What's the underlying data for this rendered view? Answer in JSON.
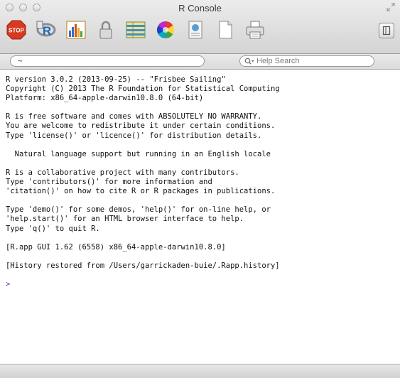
{
  "window": {
    "title": "R Console"
  },
  "toolbar": {
    "buttons": [
      {
        "icon": "stop-icon",
        "label": "STOP"
      },
      {
        "icon": "r-source-icon"
      },
      {
        "icon": "quartz-plot-icon"
      },
      {
        "icon": "lock-icon"
      },
      {
        "icon": "data-editor-icon"
      },
      {
        "icon": "color-wheel-icon"
      },
      {
        "icon": "help-icon"
      },
      {
        "icon": "new-document-icon"
      },
      {
        "icon": "print-icon"
      }
    ]
  },
  "searchbar": {
    "directory_value": "~",
    "help_placeholder": "Help Search"
  },
  "console": {
    "blocks": [
      [
        "R version 3.0.2 (2013-09-25) -- \"Frisbee Sailing\"",
        "Copyright (C) 2013 The R Foundation for Statistical Computing",
        "Platform: x86_64-apple-darwin10.8.0 (64-bit)"
      ],
      [
        "R is free software and comes with ABSOLUTELY NO WARRANTY.",
        "You are welcome to redistribute it under certain conditions.",
        "Type 'license()' or 'licence()' for distribution details."
      ],
      [
        "  Natural language support but running in an English locale"
      ],
      [
        "R is a collaborative project with many contributors.",
        "Type 'contributors()' for more information and",
        "'citation()' on how to cite R or R packages in publications."
      ],
      [
        "Type 'demo()' for some demos, 'help()' for on-line help, or",
        "'help.start()' for an HTML browser interface to help.",
        "Type 'q()' to quit R."
      ],
      [
        "[R.app GUI 1.62 (6558) x86_64-apple-darwin10.8.0]"
      ],
      [
        "[History restored from /Users/garrickaden-buie/.Rapp.history]"
      ]
    ],
    "prompt": ">"
  },
  "colors": {
    "prompt": "#7a1fd6",
    "stop": "#d9391f"
  }
}
